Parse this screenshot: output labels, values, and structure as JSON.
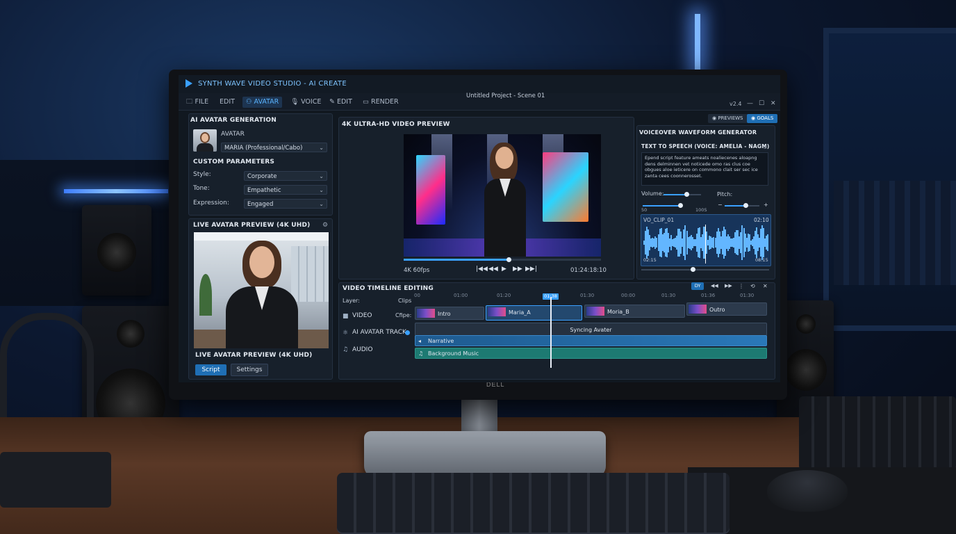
{
  "app": {
    "name": "SYNTH WAVE VIDEO STUDIO - AI CREATE",
    "project_title": "Untitled Project - Scene 01",
    "version": "v2.4",
    "window_controls": [
      "—",
      "☐",
      "✕"
    ],
    "monitor_brand": "DELL"
  },
  "menu": [
    {
      "label": "FILE",
      "icon": "folder-icon"
    },
    {
      "label": "EDIT",
      "icon": ""
    },
    {
      "label": "AVATAR",
      "icon": "person-icon",
      "active": true
    },
    {
      "label": "VOICE",
      "icon": "microphone-icon"
    },
    {
      "label": "EDIT",
      "icon": "pencil-icon"
    },
    {
      "label": "RENDER",
      "icon": "monitor-icon"
    }
  ],
  "top_buttons": {
    "previews": "PREVIEWS",
    "goals": "GOALS"
  },
  "avatar_panel": {
    "title": "AI AVATAR GENERATION",
    "avatar_label": "AVATAR",
    "avatar_value": "MARIA (Professional/Cabo)",
    "params_title": "CUSTOM PARAMETERS",
    "params": [
      {
        "label": "Style:",
        "value": "Corporate"
      },
      {
        "label": "Tone:",
        "value": "Empathetic"
      },
      {
        "label": "Expression:",
        "value": "Engaged"
      }
    ]
  },
  "live_preview": {
    "title": "LIVE AVATAR PREVIEW (4K UHD)",
    "caption": "LIVE AVATAR PREVIEW (4K UHD)",
    "tabs": {
      "script": "Script",
      "settings": "Settings"
    }
  },
  "video_preview": {
    "title": "4K ULTRA-HD VIDEO PREVIEW",
    "format": "4K 60fps",
    "timecode": "01:24:18:10",
    "progress": 0.53,
    "controls": [
      "|◀◀",
      "◀◀",
      "▶",
      "▶▶",
      "▶▶|"
    ]
  },
  "voice_panel": {
    "title": "VOICEOVER WAVEFORM GENERATOR",
    "tts_title": "TEXT TO SPEECH (VOICE: AMELIA - NAGM)",
    "script_text": "Epend script feature ameats noaliecenes aloapng dens delminnen vet noticede omo ras clus coe obgues aloe ieticere on commono clait ser sec ice zanta cees coonnerosset.",
    "volume_label": "Volume:",
    "pitch_label": "Pitch:",
    "volume_level": 0.62,
    "volume_scale": [
      "50",
      "100S"
    ],
    "pitch_level": 0.6,
    "pitch_minus": "−",
    "pitch_plus": "+",
    "clip_name": "VO_CLIP_01",
    "clip_len": "02:10",
    "wave_start": "02:15",
    "wave_end": "08:15",
    "wave_position": 0.4
  },
  "timeline": {
    "title": "VIDEO TIMELINE EDITING",
    "layer_label": "Layer:",
    "clips_label": "Clips",
    "clipe_label": "Cfipe:",
    "ticks": [
      "00",
      "01:00",
      "01:20",
      "01:38",
      "01:30",
      "00:00",
      "01:30",
      "01:36",
      "01:30"
    ],
    "playhead_time": "01:38",
    "tools": [
      "DY",
      "◀◀",
      "▶▶",
      "⋮",
      "⟲",
      "✕"
    ],
    "tracks": [
      {
        "label": "VIDEO",
        "icon": "video-camera-icon"
      },
      {
        "label": "AI AVATAR TRACK",
        "icon": "ai-chip-icon"
      },
      {
        "label": "AUDIO",
        "icon": "music-note-icon"
      }
    ],
    "video_clips": [
      "Intro",
      "Maria_A",
      "Moria_B",
      "Outro"
    ],
    "avatar_track_text": "Syncing Avater",
    "audio_clips": [
      "Narrative",
      "Background Music"
    ]
  }
}
